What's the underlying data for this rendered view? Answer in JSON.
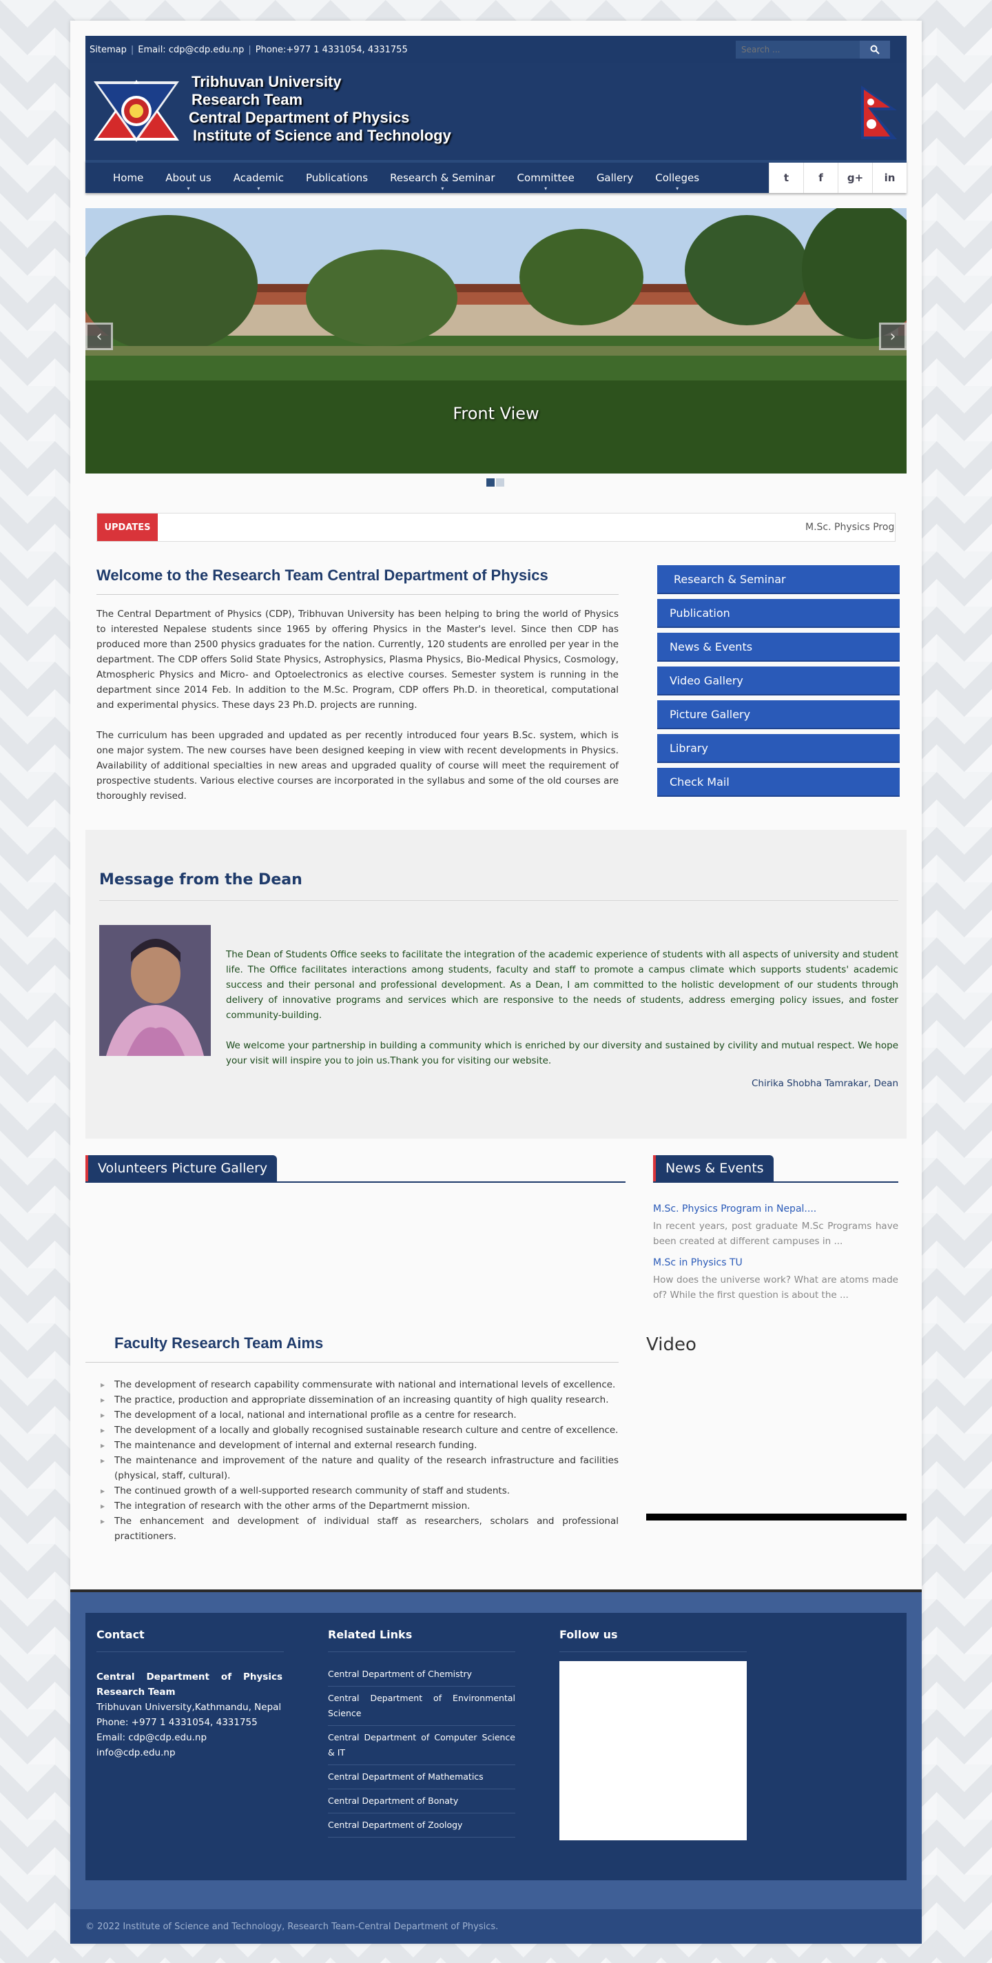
{
  "topbar": {
    "sitemap": "Sitemap",
    "email": "Email: cdp@cdp.edu.np",
    "phone": "Phone:+977 1 4331054, 4331755",
    "search_placeholder": "Search ..."
  },
  "brand": {
    "line1": "Tribhuvan University",
    "line2": "Research Team",
    "line3": "Central Department of Physics",
    "line4": "Institute of Science and Technology"
  },
  "nav": {
    "items": [
      {
        "label": "Home",
        "has_submenu": false
      },
      {
        "label": "About us",
        "has_submenu": true
      },
      {
        "label": "Academic",
        "has_submenu": true
      },
      {
        "label": "Publications",
        "has_submenu": false
      },
      {
        "label": "Research & Seminar",
        "has_submenu": true
      },
      {
        "label": "Committee",
        "has_submenu": true
      },
      {
        "label": "Gallery",
        "has_submenu": false
      },
      {
        "label": "Colleges",
        "has_submenu": true
      }
    ],
    "social": [
      "twitter-icon",
      "facebook-icon",
      "google-plus-icon",
      "linkedin-icon"
    ]
  },
  "slider": {
    "caption": "Front View",
    "prev": "‹",
    "next": "›"
  },
  "updates": {
    "label": "UPDATES",
    "ticker": "M.Sc. Physics Prog"
  },
  "welcome": {
    "title": "Welcome to the Research Team Central Department of Physics",
    "p1": "The Central Department of Physics (CDP), Tribhuvan University has been helping to bring the world of Physics to interested Nepalese students since 1965 by offering Physics in the Master's level. Since then CDP has produced more than 2500 physics graduates for the nation. Currently, 120 students are enrolled per year in the department. The CDP offers Solid State Physics, Astrophysics, Plasma Physics, Bio-Medical Physics, Cosmology, Atmospheric Physics and Micro- and Optoelectronics as elective courses. Semester system is running in the department since 2014 Feb. In addition to the M.Sc. Program, CDP offers Ph.D. in theoretical, computational and experimental physics. These days 23 Ph.D. projects are running.",
    "p2": "The curriculum has been upgraded and updated as per recently introduced four years B.Sc. system, which is one major system. The new courses have been designed keeping in view with recent developments in Physics. Availability of additional specialties in new areas and upgraded quality of course will meet the requirement of prospective students. Various elective courses are incorporated in the syllabus and some of the old courses are thoroughly revised."
  },
  "quicklinks": [
    "Research & Seminar",
    "Publication",
    "News & Events",
    "Video Gallery",
    "Picture Gallery",
    "Library",
    "Check Mail"
  ],
  "dean": {
    "title": "Message from the Dean",
    "p1": "The Dean of Students Office seeks to facilitate the integration of the academic experience of students with all aspects of university and student life. The Office facilitates interactions among students, faculty and staff to promote a campus climate which supports students' academic success and their personal and professional development. As a Dean, I am committed to the holistic development of our students through delivery of innovative programs and services which are responsive to the needs of students, address emerging policy issues, and foster community-building.",
    "p2": "We welcome your partnership in building a community which is enriched by our diversity and sustained by civility and mutual respect. We hope your visit will inspire you to join us.Thank you for visiting our website.",
    "signature": "Chirika Shobha Tamrakar, Dean"
  },
  "gallery": {
    "title": "Volunteers Picture Gallery"
  },
  "news": {
    "title": "News & Events",
    "items": [
      {
        "title": "M.Sc. Physics Program in Nepal....",
        "desc": "In recent years, post graduate M.Sc Programs have been created at different campuses in ..."
      },
      {
        "title": "M.Sc in Physics TU",
        "desc": "How does the universe work? What are atoms made of? While the first question is about the ..."
      }
    ]
  },
  "aims": {
    "title": "Faculty Research Team Aims",
    "items": [
      "The development of research capability commensurate with national and international levels of excellence.",
      "The practice, production and appropriate dissemination of an increasing quantity of high quality research.",
      "The development of a local, national and international profile as a centre for research.",
      "The development of a locally and globally recognised sustainable research culture and centre of excellence.",
      "The maintenance and development of internal and external research funding.",
      "The maintenance and improvement of the nature and quality of the research infrastructure and facilities (physical, staff, cultural).",
      "The continued growth of a well-supported research community of staff and students.",
      "The integration of research with the other arms of the Departmernt mission.",
      "The enhancement and development of individual staff as researchers, scholars and professional practitioners."
    ]
  },
  "video": {
    "title": "Video"
  },
  "footer": {
    "contact_title": "Contact",
    "org": "Central Department of Physics Research Team",
    "address": "Tribhuvan University,Kathmandu, Nepal",
    "phone": "Phone: +977 1 4331054, 4331755",
    "email": "Email: cdp@cdp.edu.np",
    "email2": "info@cdp.edu.np",
    "related_title": "Related Links",
    "related": [
      "Central Department of Chemistry",
      "Central Department of Environmental Science",
      "Central Department of Computer Science & IT",
      "Central Department of Mathematics",
      "Central Department of Bonaty",
      "Central Department of Zoology"
    ],
    "follow_title": "Follow us",
    "copyright": "© 2022 Institute of Science and Technology, Research Team-Central Department of Physics."
  },
  "colors": {
    "primary": "#1e3a6a",
    "accent_red": "#d9343a",
    "link_blue": "#2a5ab8"
  }
}
